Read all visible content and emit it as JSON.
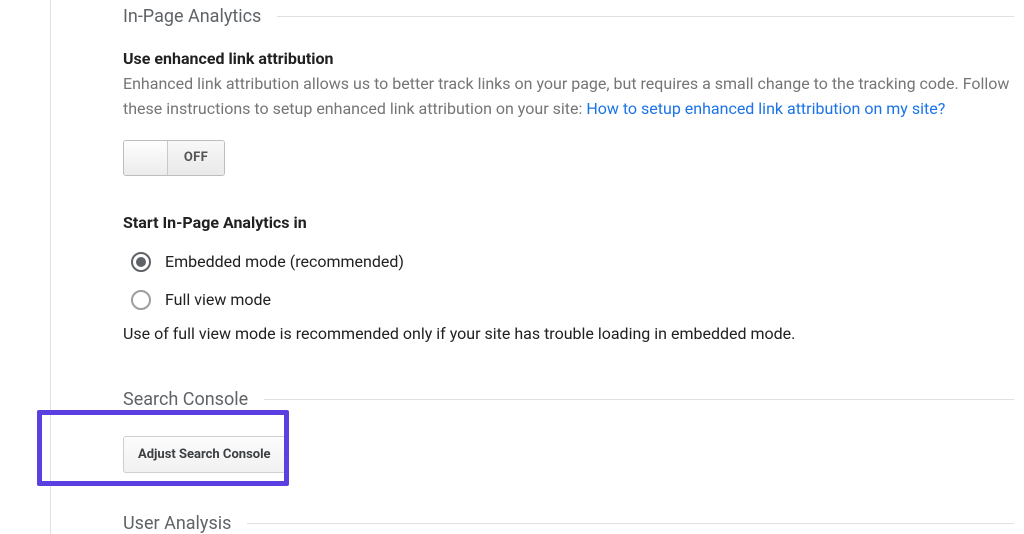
{
  "sections": {
    "inpage": {
      "title": "In-Page Analytics",
      "enhanced": {
        "heading": "Use enhanced link attribution",
        "desc_prefix": "Enhanced link attribution allows us to better track links on your page, but requires a small change to the tracking code. Follow these instructions to setup enhanced link attribution on your site: ",
        "link_text": "How to setup enhanced link attribution on my site?",
        "toggle_state": "OFF"
      },
      "start_in": {
        "heading": "Start In-Page Analytics in",
        "options": {
          "embedded": "Embedded mode (recommended)",
          "fullview": "Full view mode"
        },
        "note": "Use of full view mode is recommended only if your site has trouble loading in embedded mode."
      }
    },
    "search_console": {
      "title": "Search Console",
      "button": "Adjust Search Console"
    },
    "user_analysis": {
      "title": "User Analysis"
    }
  }
}
